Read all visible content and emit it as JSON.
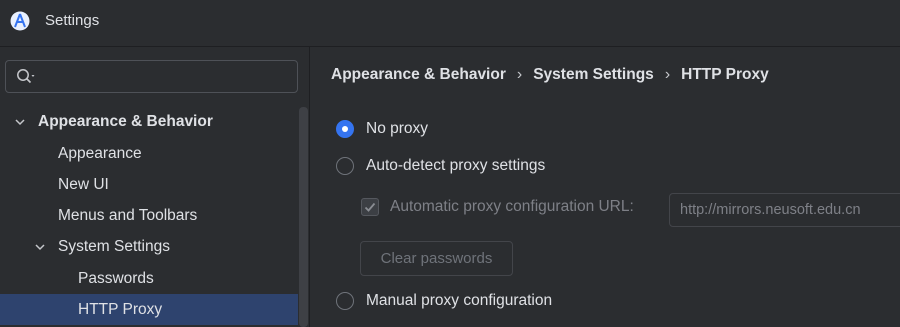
{
  "window": {
    "title": "Settings",
    "app_icon": "android-studio-icon"
  },
  "search": {
    "placeholder": "",
    "value": ""
  },
  "sidebar": {
    "items": [
      {
        "label": "Appearance & Behavior",
        "level": 0,
        "expanded": true,
        "bold": true
      },
      {
        "label": "Appearance",
        "level": 1
      },
      {
        "label": "New UI",
        "level": 1
      },
      {
        "label": "Menus and Toolbars",
        "level": 1
      },
      {
        "label": "System Settings",
        "level": 1,
        "expanded": true
      },
      {
        "label": "Passwords",
        "level": 2
      },
      {
        "label": "HTTP Proxy",
        "level": 2,
        "selected": true
      }
    ]
  },
  "breadcrumb": [
    "Appearance & Behavior",
    "System Settings",
    "HTTP Proxy"
  ],
  "proxy": {
    "no_proxy": {
      "label": "No proxy",
      "checked": true
    },
    "auto_detect": {
      "label": "Auto-detect proxy settings",
      "checked": false
    },
    "auto_config": {
      "label": "Automatic proxy configuration URL:",
      "checked": true,
      "enabled": false
    },
    "auto_config_url": "http://mirrors.neusoft.edu.cn",
    "clear_passwords": "Clear passwords",
    "manual": {
      "label": "Manual proxy configuration",
      "checked": false
    }
  },
  "colors": {
    "accent": "#3574f0",
    "selection": "#2e436e",
    "background": "#2b2d30"
  }
}
